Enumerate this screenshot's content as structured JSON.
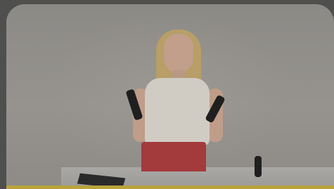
{
  "video": {
    "title": "",
    "progress_fraction": 1.0
  },
  "colors": {
    "background": "#4f4f4d",
    "progress": "#b9a33a"
  }
}
